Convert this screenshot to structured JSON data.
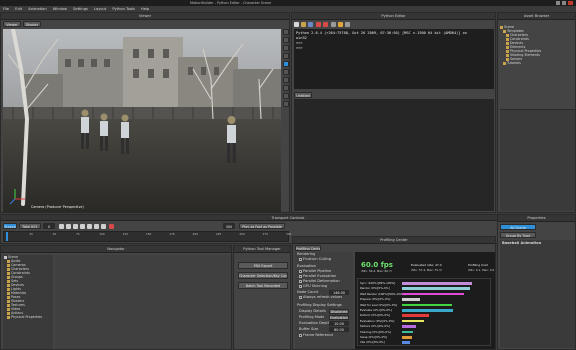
{
  "window": {
    "title": "MotionBuilder - Python Editor - Character Scene"
  },
  "menubar": {
    "items": [
      "File",
      "Edit",
      "Animation",
      "Window",
      "Settings",
      "Layout",
      "Python Tools",
      "Help"
    ]
  },
  "toolbar": {
    "layout_label": "Editing"
  },
  "viewer": {
    "title": "Viewer",
    "camera_label": "Camera (Producer Perspective)",
    "tabs": [
      "Viewer",
      "Display"
    ]
  },
  "python_editor": {
    "title": "Python Editor",
    "lines": [
      "Python 2.6.4 (r264:75708, Oct 26 2009, 07:36:50) [MSC v.1500 64 bit (AMD64)] on",
      "win32",
      ">>>",
      ">>>"
    ],
    "script_tab": "Untitled"
  },
  "asset_browser": {
    "title": "Asset Browser",
    "tree": [
      "Scene",
      "Templates",
      "Characters",
      "Constraints",
      "Devices",
      "Elements",
      "Physical Properties",
      "Shading Elements",
      "Solvers",
      "Tutorials"
    ]
  },
  "transport": {
    "title": "Transport Controls",
    "mode_label": "Stance",
    "take_label": "Take 001",
    "frame_value": "0",
    "end_value": "300",
    "playback_label": "Play as Fast as Possible",
    "timeline_ticks": [
      "0",
      "25",
      "50",
      "75",
      "100",
      "125",
      "150",
      "175",
      "200",
      "225",
      "250",
      "275",
      "300"
    ]
  },
  "navigator": {
    "title": "Navigator",
    "items": [
      "Scene",
      "Audio",
      "Cameras",
      "Characters",
      "Constraints",
      "Groups",
      "Sets",
      "Devices",
      "Lights",
      "Materials",
      "Poses",
      "Shaders",
      "Textures",
      "Video",
      "Actions",
      "Physical Properties"
    ]
  },
  "python_tool_manager": {
    "title": "Python Tool Manager",
    "buttons": [
      "FBX Export",
      "Character Selection/Key Controls",
      "Batch Tool Recorded"
    ]
  },
  "profiling": {
    "title": "Profiling Center",
    "tab": "Profiling Center",
    "rendering_label": "Rendering",
    "frustum_label": "Frustum Culling",
    "evaluation_label": "Evaluation",
    "parallel_pipeline": "Parallel Pipeline",
    "parallel_evaluation": "Parallel Evaluation",
    "parallel_deformation": "Parallel Deformation",
    "gpu_skinning": "GPU Skinning",
    "mode_count_label": "Node Count",
    "mode_count_value": "146.00",
    "always_refresh": "Always refresh values",
    "display_settings": "Profiling Display Settings",
    "display_details": "Display Details",
    "display_details_value": "Displayed",
    "profiling_mode": "Profiling Mode",
    "profiling_mode_value": "Evaluation Only",
    "eval_depth": "Evaluation Depth",
    "eval_depth_value": "10.00",
    "buffer_size": "Buffer Size",
    "buffer_size_value": "60.00",
    "frame_reference": "Frame Reference",
    "fps": "60.0 fps",
    "fps_sub": "(Min: 56.4, Max: 60.7)",
    "eval_rate": "Evaluated rate: 47.4",
    "eval_sub": "(Min: 57.4, Max: 75.3)",
    "profile_cost": "Profiling Cost",
    "profile_cost_sub": "(Min: 0.1, Max: 0.9)",
    "rows": [
      {
        "label": "Sync (100%)[99%-100%]",
        "color": "#c08ed9",
        "value": 0.88
      },
      {
        "label": "Render (0%)[0%-0%]",
        "color": "#8fd0d8",
        "value": 0.85
      },
      {
        "label": "Wait Render (100%)[99%-100%]",
        "color": "#e24bd6",
        "value": 0.78
      },
      {
        "label": "Prepare (0%)[0%-0%]",
        "color": "#d0d0d0",
        "value": 0.22
      },
      {
        "label": "Wait for eval (0%)[0%-0%]",
        "color": "#3fd63f",
        "value": 0.62
      },
      {
        "label": "Evaluate (0%)[0%-0%]",
        "color": "#3aa9c9",
        "value": 0.64
      },
      {
        "label": "Deform (0%)[0%-0%]",
        "color": "#e03a3a",
        "value": 0.34
      },
      {
        "label": "Evaluation (0%)[0%-0%]",
        "color": "#e8e860",
        "value": 0.28
      },
      {
        "label": "Texture (0%)[0%-0%]",
        "color": "#b66ce0",
        "value": 0.18
      },
      {
        "label": "Shading (0%)[0%-0%]",
        "color": "#3cbc9a",
        "value": 0.14
      },
      {
        "label": "Swap (0%)[0%-0%]",
        "color": "#e09a3a",
        "value": 0.12
      },
      {
        "label": "Idle (0%)[0%-0%]",
        "color": "#5a8ae0",
        "value": 0.1
      }
    ]
  },
  "properties": {
    "title": "Properties",
    "filter_label": "All Scene",
    "group_label": "Group By Type",
    "header": "Baseball Animation"
  },
  "colors": {
    "accent": "#2f8fd8",
    "fps_green": "#6fe06f",
    "panel_bg": "#444444",
    "dark_bg": "#2b2b2b"
  }
}
